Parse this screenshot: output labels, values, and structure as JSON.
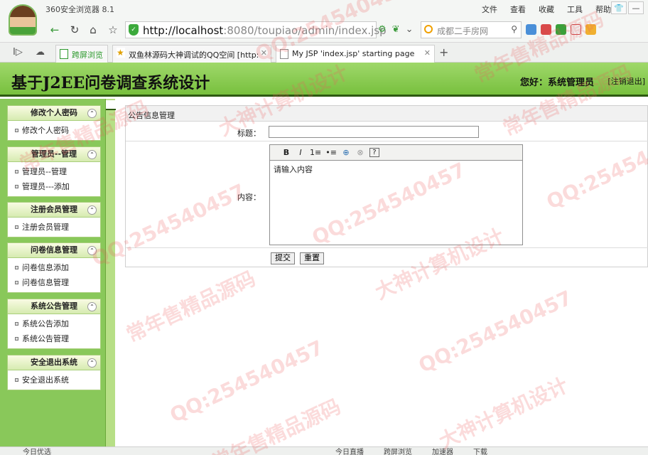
{
  "browser": {
    "app_name": "360安全浏览器 8.1",
    "menu": [
      "文件",
      "查看",
      "收藏",
      "工具",
      "帮助"
    ],
    "url_host": "http://localhost",
    "url_path": ":8080/toupiao/admin/index.jsp",
    "search_text": "成都二手房网",
    "tabs": [
      {
        "label": "跨屏浏览",
        "active": false
      },
      {
        "label": "双鱼林源码大神调试的QQ空间 [http:",
        "active": false
      },
      {
        "label": "My JSP 'index.jsp' starting page",
        "active": true
      }
    ],
    "status_left": "今日优选",
    "status_right": [
      "今日直播",
      "跨屏浏览",
      "加速器",
      "下载"
    ]
  },
  "header": {
    "title": "基于J2EE问卷调查系统设计",
    "greeting": "您好：系统管理员",
    "logout": "[注销退出]"
  },
  "sidebar": {
    "groups": [
      {
        "title": "修改个人密码",
        "items": [
          "修改个人密码"
        ]
      },
      {
        "title": "管理员--管理",
        "items": [
          "管理员--管理",
          "管理员---添加"
        ]
      },
      {
        "title": "注册会员管理",
        "items": [
          "注册会员管理"
        ]
      },
      {
        "title": "问卷信息管理",
        "items": [
          "问卷信息添加",
          "问卷信息管理"
        ]
      },
      {
        "title": "系统公告管理",
        "items": [
          "系统公告添加",
          "系统公告管理"
        ]
      },
      {
        "title": "安全退出系统",
        "items": [
          "安全退出系统"
        ]
      }
    ]
  },
  "form": {
    "section_title": "公告信息管理",
    "title_label": "标题：",
    "title_value": "",
    "content_label": "内容：",
    "content_value": "请输入内容",
    "toolbar": [
      "B",
      "I",
      "1≡",
      "•≡",
      "⊕",
      "⊗",
      "?"
    ],
    "submit_label": "提交",
    "reset_label": "重置"
  },
  "watermark": {
    "qq": "QQ:254540457",
    "text1": "大神计算机设计",
    "text2": "常年售精品源码"
  }
}
